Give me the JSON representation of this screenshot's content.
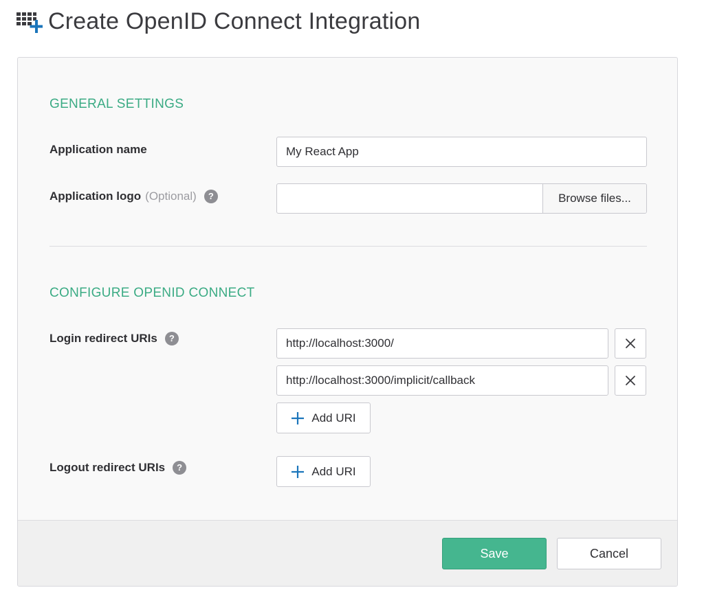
{
  "page": {
    "title": "Create OpenID Connect Integration",
    "header_icon": "grid-plus-icon"
  },
  "general": {
    "section_title": "GENERAL SETTINGS",
    "app_name_label": "Application name",
    "app_name_value": "My React App",
    "app_logo_label": "Application logo",
    "app_logo_optional": "(Optional)",
    "help_glyph": "?",
    "browse_label": "Browse files..."
  },
  "oidc": {
    "section_title": "CONFIGURE OPENID CONNECT",
    "login_label": "Login redirect URIs",
    "login_uris": [
      "http://localhost:3000/",
      "http://localhost:3000/implicit/callback"
    ],
    "add_uri_label": "Add URI",
    "logout_label": "Logout redirect URIs"
  },
  "footer": {
    "save_label": "Save",
    "cancel_label": "Cancel"
  },
  "colors": {
    "accent": "#3bab84",
    "save_button": "#45b68f",
    "plus_icon": "#1b75bb",
    "help_icon": "#8e8e93"
  },
  "icons": {
    "help": "question-icon",
    "remove": "close-icon",
    "add": "plus-icon"
  }
}
